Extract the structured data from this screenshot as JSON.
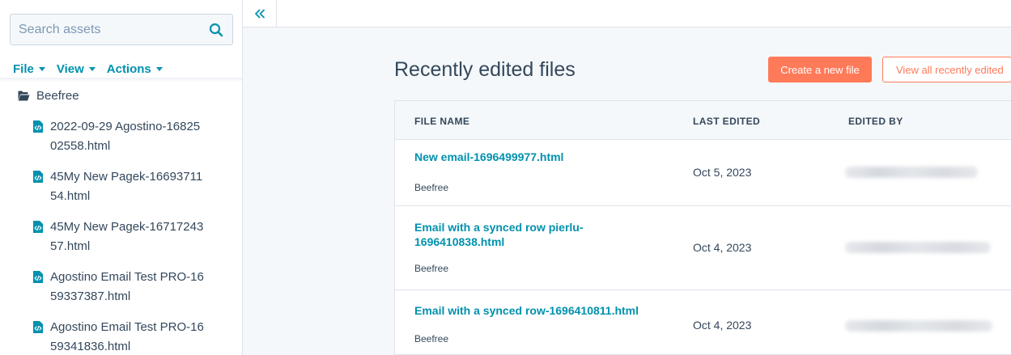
{
  "sidebar": {
    "search": {
      "placeholder": "Search assets",
      "icon": "search-icon"
    },
    "menus": [
      {
        "label": "File"
      },
      {
        "label": "View"
      },
      {
        "label": "Actions"
      }
    ],
    "root_folder": {
      "label": "Beefree",
      "icon": "folder-open-icon"
    },
    "files": [
      {
        "label": "2022-09-29 Agostino-1682502558.html"
      },
      {
        "label": "45My New Pagek-1669371154.html"
      },
      {
        "label": "45My New Pagek-1671724357.html"
      },
      {
        "label": "Agostino Email Test PRO-1659337387.html"
      },
      {
        "label": "Agostino Email Test PRO-1659341836.html"
      }
    ]
  },
  "topbar": {
    "collapse_icon": "double-chevron-left-icon"
  },
  "main": {
    "title": "Recently edited files",
    "create_button": "Create a new file",
    "view_all_button": "View all recently edited",
    "columns": {
      "file_name": "FILE NAME",
      "last_edited": "LAST EDITED",
      "edited_by": "EDITED BY"
    },
    "rows": [
      {
        "name": "New email-1696499977.html",
        "folder": "Beefree",
        "date": "Oct 5, 2023"
      },
      {
        "name": "Email with a synced row pierlu-1696410838.html",
        "folder": "Beefree",
        "date": "Oct 4, 2023"
      },
      {
        "name": "Email with a synced row-1696410811.html",
        "folder": "Beefree",
        "date": "Oct 4, 2023"
      }
    ]
  },
  "colors": {
    "accent": "#0091ae",
    "primary_button": "#ff7a59",
    "text": "#33475b",
    "border": "#dfe3eb"
  }
}
